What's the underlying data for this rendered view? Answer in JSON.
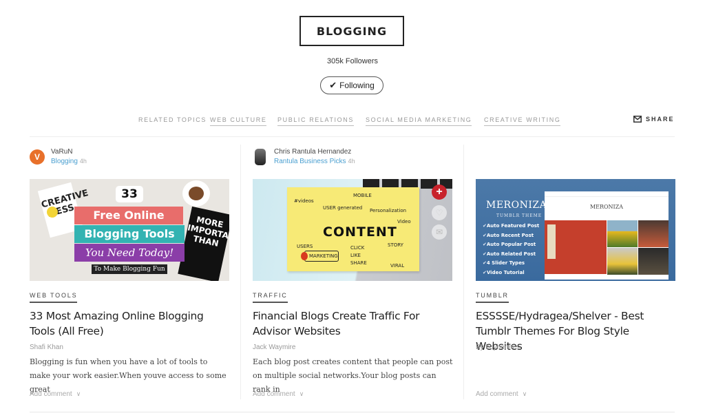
{
  "topic": {
    "title": "BLOGGING",
    "followers": "305k Followers",
    "following_label": "Following",
    "following_icon": "checkmark-icon"
  },
  "nav": {
    "related_label": "RELATED TOPICS",
    "links": [
      "WEB CULTURE",
      "PUBLIC RELATIONS",
      "SOCIAL MEDIA MARKETING",
      "CREATIVE WRITING"
    ],
    "share_label": "SHARE",
    "share_icon": "mail-icon"
  },
  "cards": [
    {
      "author": "VaRuN",
      "avatar_letter": "V",
      "publication": "Blogging",
      "time": "4h",
      "thumb": {
        "badge": "33",
        "line1": "Free Online",
        "line2": "Blogging Tools",
        "line3": "You Need Today!",
        "strap": "To Make Blogging Fun",
        "left_poster": "CREATIVE MESS",
        "right_poster": "MORE IMPORTANT THAN"
      },
      "tag": "WEB TOOLS",
      "title": "33 Most Amazing Online Blogging Tools (All Free)",
      "byline": "Shafi Khan",
      "excerpt": "Blogging is fun when you have a lot of tools to make your work easier.When youve access to some great",
      "comment_label": "Add comment"
    },
    {
      "author": "Chris Rantula Hernandez",
      "publication": "Rantula Business Picks",
      "time": "4h",
      "thumb": {
        "center_word": "CONTENT",
        "words": [
          "#videos",
          "MOBILE",
          "USER generated",
          "Personalization",
          "Video",
          "USERS",
          "MARKETING",
          "CLICK",
          "LIKE",
          "SHARE",
          "STORY",
          "VIRAL"
        ]
      },
      "tag": "TRAFFIC",
      "title": "Financial Blogs Create Traffic For Advisor Websites",
      "byline": "Jack Waymire",
      "excerpt": "Each blog post creates content that people can post on multiple social networks.Your blog posts can rank in",
      "comment_label": "Add comment"
    },
    {
      "thumb": {
        "brand": "MERONIZA",
        "subtitle": "TUMBLR THEME",
        "features": [
          "Auto Featured Post",
          "Auto Recent Post",
          "Auto Popular Post",
          "Auto Related Post",
          "4 Slider Types",
          "Video Tutorial"
        ],
        "site_logo": "MERONIZA"
      },
      "tag": "TUMBLR",
      "title": "ESSSSE/Hydragea/Shelver - Best Tumblr Themes For Blog Style Websites",
      "byline": "By boyhermes",
      "comment_label": "Add comment"
    }
  ],
  "overlay_buttons": {
    "add_icon": "plus-icon",
    "like_icon": "heart-icon",
    "mail_icon": "mail-icon"
  }
}
